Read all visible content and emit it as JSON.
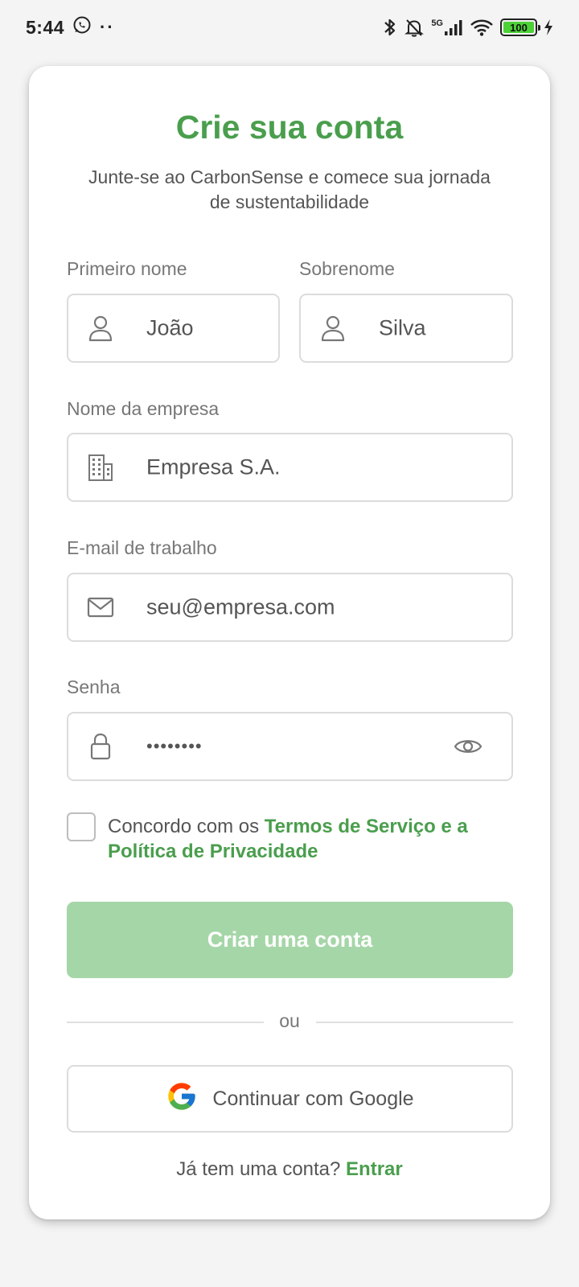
{
  "status_bar": {
    "time": "5:44",
    "dots": "··",
    "battery": "100",
    "network": "5G"
  },
  "header": {
    "title": "Crie sua conta",
    "subtitle": "Junte-se ao CarbonSense e comece sua jornada de sustentabilidade"
  },
  "form": {
    "first_name": {
      "label": "Primeiro nome",
      "value": "João",
      "icon": "user-icon"
    },
    "last_name": {
      "label": "Sobrenome",
      "value": "Silva",
      "icon": "user-icon"
    },
    "company": {
      "label": "Nome da empresa",
      "value": "Empresa S.A.",
      "icon": "building-icon"
    },
    "email": {
      "label": "E-mail de trabalho",
      "value": "seu@empresa.com",
      "icon": "mail-icon"
    },
    "password": {
      "label": "Senha",
      "value": "••••••••",
      "icon": "lock-icon",
      "toggle_icon": "eye-icon"
    },
    "terms": {
      "prefix": "Concordo com os ",
      "link": "Termos de Serviço e a Política de Privacidade",
      "checked": false
    },
    "submit_label": "Criar uma conta",
    "divider_text": "ou",
    "google_label": "Continuar com Google"
  },
  "footer": {
    "prompt": "Já tem uma conta? ",
    "link": "Entrar"
  },
  "colors": {
    "accent": "#4a9e4d",
    "button_disabled": "#a5d6a7",
    "border": "#dcdcdc"
  }
}
